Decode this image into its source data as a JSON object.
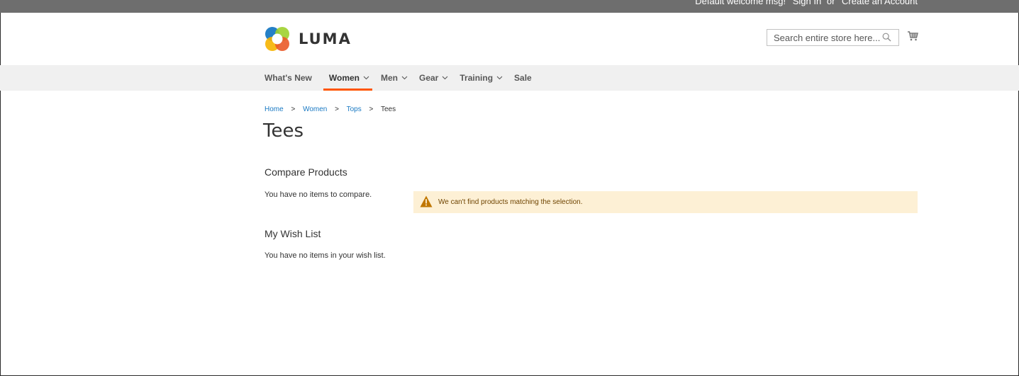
{
  "panel": {
    "welcome": "Default welcome msg!",
    "sign_in": "Sign In",
    "or": "or",
    "create_account": "Create an Account"
  },
  "header": {
    "logo_text": "LUMA",
    "search_placeholder": "Search entire store here...",
    "search_icon": "search-icon",
    "cart_icon": "cart-icon"
  },
  "nav": {
    "items": [
      {
        "label": "What's New",
        "has_dropdown": false
      },
      {
        "label": "Women",
        "has_dropdown": true,
        "active": true
      },
      {
        "label": "Men",
        "has_dropdown": true
      },
      {
        "label": "Gear",
        "has_dropdown": true
      },
      {
        "label": "Training",
        "has_dropdown": true
      },
      {
        "label": "Sale",
        "has_dropdown": false
      }
    ],
    "active_color": "#ff5501"
  },
  "breadcrumbs": {
    "items": [
      "Home",
      "Women",
      "Tops"
    ],
    "current": "Tees"
  },
  "page": {
    "title": "Tees"
  },
  "sidebar": {
    "compare_title": "Compare Products",
    "compare_empty": "You have no items to compare.",
    "wishlist_title": "My Wish List",
    "wishlist_empty": "You have no items in your wish list."
  },
  "message": {
    "text": "We can't find products matching the selection.",
    "icon": "warning-icon",
    "background": "#fdf0d5"
  },
  "colors": {
    "link": "#1979c3",
    "panel_bg": "#6e6e6e",
    "nav_bg": "#f0f0f0"
  }
}
